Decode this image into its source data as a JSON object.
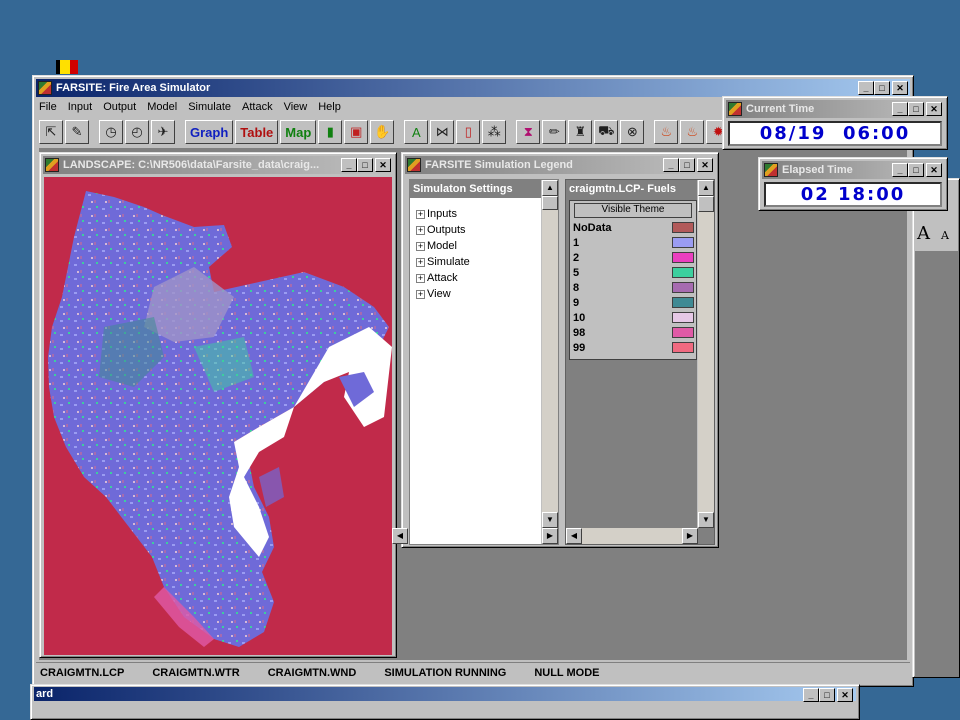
{
  "main_window": {
    "title": "FARSITE: Fire Area Simulator",
    "menu": [
      "File",
      "Input",
      "Output",
      "Model",
      "Simulate",
      "Attack",
      "View",
      "Help"
    ],
    "toolbar": {
      "graph": "Graph",
      "table": "Table",
      "map": "Map"
    },
    "status": [
      "CRAIGMTN.LCP",
      "CRAIGMTN.WTR",
      "CRAIGMTN.WND",
      "SIMULATION RUNNING",
      "NULL MODE"
    ]
  },
  "landscape_window": {
    "title": "LANDSCAPE: C:\\NR506\\data\\Farsite_data\\craig..."
  },
  "legend_window": {
    "title": "FARSITE Simulation Legend",
    "settings_title": "Simulaton Settings",
    "settings_items": [
      "Inputs",
      "Outputs",
      "Model",
      "Simulate",
      "Attack",
      "View"
    ],
    "fuels_title": "craigmtn.LCP- Fuels",
    "theme_label": "Visible Theme",
    "fuels": [
      {
        "label": "NoData",
        "color": "#b25a5a"
      },
      {
        "label": "1",
        "color": "#9a9cf2"
      },
      {
        "label": "2",
        "color": "#ea3fbf"
      },
      {
        "label": "5",
        "color": "#3ccf9e"
      },
      {
        "label": "8",
        "color": "#a66bb0"
      },
      {
        "label": "9",
        "color": "#3f8a94"
      },
      {
        "label": "10",
        "color": "#e6c8e6"
      },
      {
        "label": "98",
        "color": "#e05aa6"
      },
      {
        "label": "99",
        "color": "#f06a80"
      }
    ]
  },
  "current_time": {
    "title": "Current Time",
    "value": "08/19  06:00"
  },
  "elapsed_time": {
    "title": "Elapsed Time",
    "value": "02 18:00"
  },
  "bottom_window": {
    "title": "ard"
  },
  "colors": {
    "desktop": "#356895",
    "map_background": "#c12a4a",
    "landscape_blue": "#6f6ad8",
    "burned": "#ffffff"
  }
}
